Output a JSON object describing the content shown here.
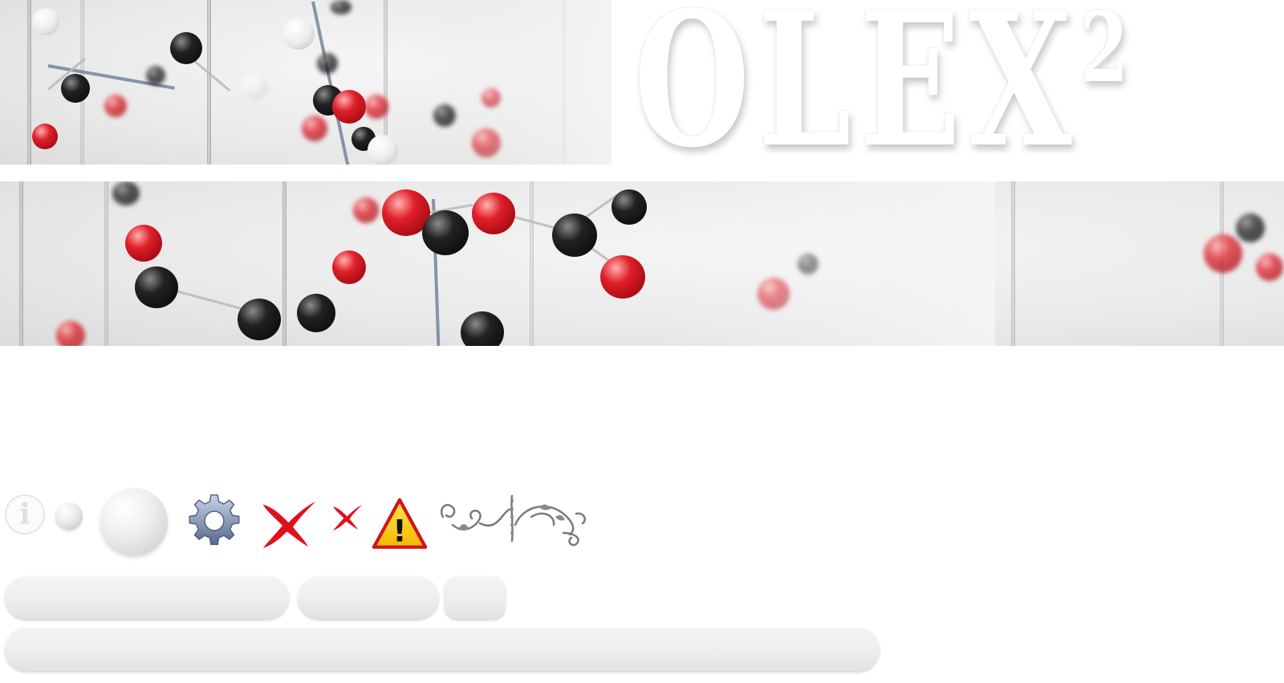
{
  "logo": {
    "text": "OLEX",
    "superscript": "2"
  },
  "banners": [
    {
      "name": "molecule-model-photo-top"
    },
    {
      "name": "molecule-model-photo-band"
    }
  ],
  "icons": [
    {
      "name": "info-icon",
      "glyph": "i"
    },
    {
      "name": "small-orb-icon"
    },
    {
      "name": "large-orb-icon"
    },
    {
      "name": "gear-icon"
    },
    {
      "name": "cross-large-icon",
      "color": "#e0101c"
    },
    {
      "name": "cross-small-icon",
      "color": "#e0101c"
    },
    {
      "name": "warning-icon",
      "glyph": "!",
      "color": "#f7d100"
    },
    {
      "name": "ornament-icon"
    }
  ],
  "buttons": [
    {
      "name": "blank-button-1",
      "label": ""
    },
    {
      "name": "blank-button-2",
      "label": ""
    },
    {
      "name": "blank-button-3",
      "label": ""
    },
    {
      "name": "blank-wide-bar",
      "label": ""
    }
  ]
}
